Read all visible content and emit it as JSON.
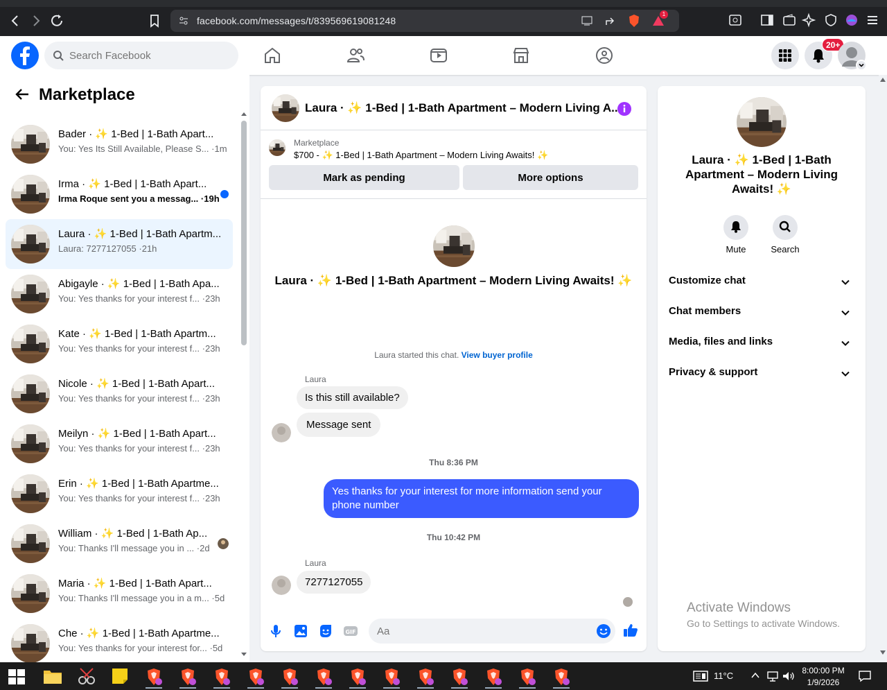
{
  "browser": {
    "url": "facebook.com/messages/t/839569619081248",
    "badge_count": "1"
  },
  "fbnav": {
    "search_placeholder": "Search Facebook",
    "notifications_badge": "20+"
  },
  "sidebar": {
    "title": "Marketplace",
    "conversations": [
      {
        "name": "Bader · ✨ 1-Bed | 1-Bath Apart...",
        "snippet": "You: Yes Its Still Available, Please S... ·1m",
        "unread": false,
        "active": false
      },
      {
        "name": "Irma · ✨ 1-Bed | 1-Bath Apart...",
        "snippet": "Irma Roque sent you a messag... ·19h",
        "unread": true,
        "active": false
      },
      {
        "name": "Laura · ✨ 1-Bed | 1-Bath Apartm...",
        "snippet": "Laura: 7277127055 ·21h",
        "unread": false,
        "active": true
      },
      {
        "name": "Abigayle · ✨ 1-Bed | 1-Bath Apa...",
        "snippet": "You: Yes thanks for your interest f... ·23h",
        "unread": false,
        "active": false
      },
      {
        "name": "Kate · ✨ 1-Bed | 1-Bath Apartm...",
        "snippet": "You: Yes thanks for your interest f... ·23h",
        "unread": false,
        "active": false
      },
      {
        "name": "Nicole · ✨ 1-Bed | 1-Bath Apart...",
        "snippet": "You: Yes thanks for your interest f... ·23h",
        "unread": false,
        "active": false
      },
      {
        "name": "Meilyn · ✨ 1-Bed | 1-Bath Apart...",
        "snippet": "You: Yes thanks for your interest f... ·23h",
        "unread": false,
        "active": false
      },
      {
        "name": "Erin · ✨ 1-Bed | 1-Bath Apartme...",
        "snippet": "You: Yes thanks for your interest f... ·23h",
        "unread": false,
        "active": false
      },
      {
        "name": "William · ✨ 1-Bed | 1-Bath Ap...",
        "snippet": "You: Thanks I'll message you in ... ·2d",
        "unread": false,
        "active": false,
        "seen": true
      },
      {
        "name": "Maria · ✨ 1-Bed | 1-Bath Apart...",
        "snippet": "You: Thanks I'll message you in a m... ·5d",
        "unread": false,
        "active": false
      },
      {
        "name": "Che · ✨ 1-Bed | 1-Bath Apartme...",
        "snippet": "You: Yes thanks for your interest for... ·5d",
        "unread": false,
        "active": false
      }
    ]
  },
  "chat": {
    "header_title": "Laura · ✨ 1-Bed | 1-Bath Apartment – Modern Living A...",
    "marketplace_label": "Marketplace",
    "listing": "$700 - ✨ 1-Bed | 1-Bath Apartment – Modern Living Awaits! ✨",
    "mark_pending": "Mark as pending",
    "more_options": "More options",
    "conversation_title": "Laura · ✨ 1-Bed | 1-Bath Apartment – Modern Living Awaits! ✨",
    "started_text": "Laura started this chat.",
    "buyer_profile_link": "View buyer profile",
    "sender_1": "Laura",
    "msg_1": "Is this still available?",
    "msg_2": "Message sent",
    "stamp_1": "Thu 8:36 PM",
    "msg_out": "Yes thanks for your interest for more information send your phone number",
    "stamp_2": "Thu 10:42 PM",
    "sender_2": "Laura",
    "msg_3": "7277127055",
    "input_placeholder": "Aa"
  },
  "rpanel": {
    "name": "Laura · ✨ 1-Bed | 1-Bath Apartment – Modern Living Awaits! ✨",
    "mute_label": "Mute",
    "search_label": "Search",
    "rows": [
      "Customize chat",
      "Chat members",
      "Media, files and links",
      "Privacy & support"
    ]
  },
  "watermark": {
    "line1": "Activate Windows",
    "line2": "Go to Settings to activate Windows."
  },
  "taskbar": {
    "temperature": "11°C",
    "time": "8:00:00 PM",
    "date": "1/9/2026"
  },
  "colors": {
    "fb_blue": "#0866ff",
    "outgoing_bubble": "#3b5bff",
    "badge_red": "#e41e3f",
    "info_purple": "#a033ff"
  }
}
